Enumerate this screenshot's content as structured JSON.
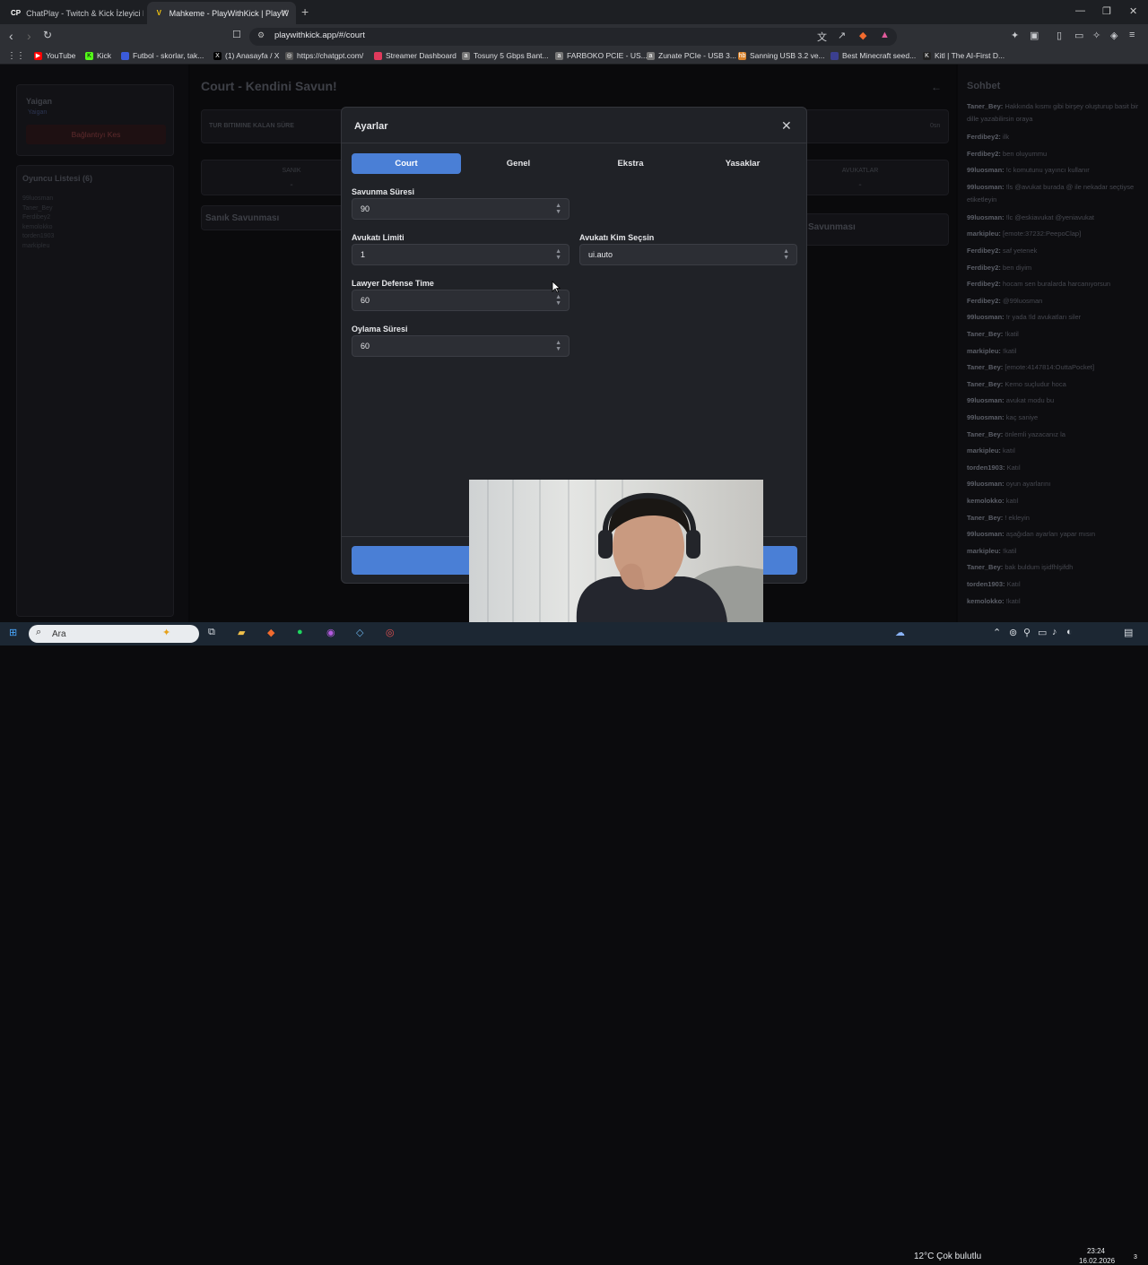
{
  "browser": {
    "tabs": [
      {
        "title": "ChatPlay - Twitch & Kick İzleyici Etkile",
        "icon": "CP"
      },
      {
        "title": "Mahkeme - PlayWithKick | PlayW",
        "icon": "V"
      }
    ],
    "url": "playwithkick.app/#/court",
    "bookmarks": [
      {
        "label": "YouTube",
        "color": "#ff0000"
      },
      {
        "label": "Kick",
        "color": "#53fc18"
      },
      {
        "label": "Futbol - skorlar, tak...",
        "color": "#3b5bdb"
      },
      {
        "label": "(1) Anasayfa / X",
        "color": "#000000"
      },
      {
        "label": "https://chatgpt.com/",
        "color": "#555555"
      },
      {
        "label": "Streamer Dashboard",
        "color": "#e03a5c"
      },
      {
        "label": "Tosuny 5 Gbps Bant...",
        "color": "#777777"
      },
      {
        "label": "FARBOKO PCIE - US...",
        "color": "#777777"
      },
      {
        "label": "Zunate PCIe - USB 3...",
        "color": "#777777"
      },
      {
        "label": "Sanning USB 3.2 ve...",
        "color": "#d9822b"
      },
      {
        "label": "Best Minecraft seed...",
        "color": "#3b3f8f"
      },
      {
        "label": "Kitl | The AI-First D...",
        "color": "#222222"
      }
    ]
  },
  "left": {
    "user": "Yaigan",
    "user_sub": "Yaigan",
    "disconnect": "Bağlantıyı Kes",
    "players_title": "Oyuncu Listesi (6)",
    "players": [
      "99luosman",
      "Taner_Bey",
      "Ferdibey2",
      "kemolokko",
      "torden1903",
      "markipleu"
    ]
  },
  "center": {
    "title": "Court - Kendini Savun!",
    "timer_label": "TUR BITIMINE KALAN SÜRE",
    "timer_value": "0sn",
    "defendant_label": "SANIK",
    "defendant_value": "-",
    "lawyers_label": "AVUKATLAR",
    "lawyers_value": "-",
    "defense_title": "Sanık Savunması",
    "lawyer_defense_title": "Savunması"
  },
  "modal": {
    "title": "Ayarlar",
    "tabs": [
      "Court",
      "Genel",
      "Ekstra",
      "Yasaklar"
    ],
    "fields": {
      "savunma_label": "Savunma Süresi",
      "savunma_value": "90",
      "avukat_limit_label": "Avukatı Limiti",
      "avukat_limit_value": "1",
      "avukat_sec_label": "Avukatı Kim Seçsin",
      "avukat_sec_value": "ui.auto",
      "lawyer_time_label": "Lawyer Defense Time",
      "lawyer_time_value": "60",
      "oylama_label": "Oylama Süresi",
      "oylama_value": "60"
    }
  },
  "chat": {
    "title": "Sohbet",
    "messages": [
      {
        "user": "Taner_Bey:",
        "text": "Hakkında kısmı gibi birşey oluşturup basit bir dille yazabilirsin oraya"
      },
      {
        "user": "Ferdibey2:",
        "text": "ilk"
      },
      {
        "user": "Ferdibey2:",
        "text": "ben oluyummu"
      },
      {
        "user": "99luosman:",
        "text": "!c komutunu yayıncı kullanır"
      },
      {
        "user": "99luosman:",
        "text": "!ls @avukat burada @ ile nekadar seçtiyse etiketleyin"
      },
      {
        "user": "99luosman:",
        "text": "!lc @eskiavukat @yeniavukat"
      },
      {
        "user": "markipleu:",
        "text": "[emote:37232:PeepoClap]"
      },
      {
        "user": "Ferdibey2:",
        "text": "saf yetenek"
      },
      {
        "user": "Ferdibey2:",
        "text": "ben diyim"
      },
      {
        "user": "Ferdibey2:",
        "text": "hocam sen buralarda harcanıyorsun"
      },
      {
        "user": "Ferdibey2:",
        "text": "@99luosman"
      },
      {
        "user": "99luosman:",
        "text": "!r yada !ld avukatları siler"
      },
      {
        "user": "Taner_Bey:",
        "text": "!katil"
      },
      {
        "user": "markipleu:",
        "text": "!katil"
      },
      {
        "user": "Taner_Bey:",
        "text": "[emote:4147814:OuttaPocket]"
      },
      {
        "user": "Taner_Bey:",
        "text": "Kemo suçludur hoca"
      },
      {
        "user": "99luosman:",
        "text": "avukat modu bu"
      },
      {
        "user": "99luosman:",
        "text": "kaç saniye"
      },
      {
        "user": "Taner_Bey:",
        "text": "önlemli yazacanız la"
      },
      {
        "user": "markipleu:",
        "text": "katıl"
      },
      {
        "user": "torden1903:",
        "text": "Katıl"
      },
      {
        "user": "99luosman:",
        "text": "oyun ayarlarını"
      },
      {
        "user": "kemolokko:",
        "text": "katıl"
      },
      {
        "user": "Taner_Bey:",
        "text": "! ekleyin"
      },
      {
        "user": "99luosman:",
        "text": "aşağıdan ayarları yapar mısın"
      },
      {
        "user": "markipleu:",
        "text": "!katil"
      },
      {
        "user": "Taner_Bey:",
        "text": "bak buldum işidfhlşifdh"
      },
      {
        "user": "torden1903:",
        "text": "Katıl"
      },
      {
        "user": "kemolokko:",
        "text": "!katıl"
      }
    ]
  },
  "taskbar": {
    "search": "Ara",
    "weather": "12°C  Çok bulutlu",
    "time": "23:24",
    "date": "16.02.2026",
    "notif_count": "3"
  }
}
